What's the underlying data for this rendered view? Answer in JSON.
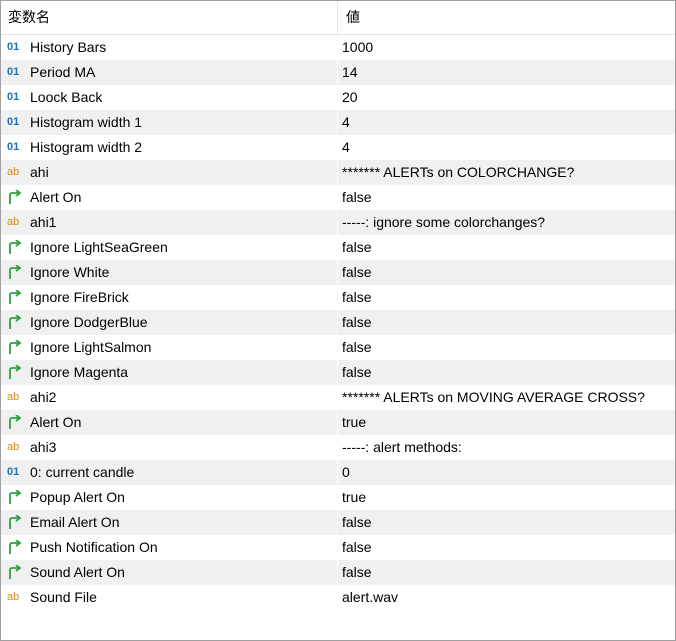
{
  "header": {
    "name": "変数名",
    "value": "値"
  },
  "rows": [
    {
      "type": "int",
      "icon": "int-icon",
      "name": "History Bars",
      "value": "1000"
    },
    {
      "type": "int",
      "icon": "int-icon",
      "name": "Period MA",
      "value": "14"
    },
    {
      "type": "int",
      "icon": "int-icon",
      "name": "Loock Back",
      "value": "20"
    },
    {
      "type": "int",
      "icon": "int-icon",
      "name": "Histogram width 1",
      "value": "4"
    },
    {
      "type": "int",
      "icon": "int-icon",
      "name": "Histogram width 2",
      "value": "4"
    },
    {
      "type": "str",
      "icon": "string-icon",
      "name": "ahi",
      "value": "******* ALERTs on COLORCHANGE?"
    },
    {
      "type": "bool",
      "icon": "bool-icon",
      "name": "Alert On",
      "value": "false"
    },
    {
      "type": "str",
      "icon": "string-icon",
      "name": "ahi1",
      "value": "-----: ignore some colorchanges?"
    },
    {
      "type": "bool",
      "icon": "bool-icon",
      "name": "Ignore LightSeaGreen",
      "value": "false"
    },
    {
      "type": "bool",
      "icon": "bool-icon",
      "name": "Ignore White",
      "value": "false"
    },
    {
      "type": "bool",
      "icon": "bool-icon",
      "name": "Ignore FireBrick",
      "value": "false"
    },
    {
      "type": "bool",
      "icon": "bool-icon",
      "name": "Ignore DodgerBlue",
      "value": "false"
    },
    {
      "type": "bool",
      "icon": "bool-icon",
      "name": "Ignore LightSalmon",
      "value": "false"
    },
    {
      "type": "bool",
      "icon": "bool-icon",
      "name": "Ignore Magenta",
      "value": "false"
    },
    {
      "type": "str",
      "icon": "string-icon",
      "name": "ahi2",
      "value": "******* ALERTs on MOVING AVERAGE CROSS?"
    },
    {
      "type": "bool",
      "icon": "bool-icon",
      "name": "Alert On",
      "value": "true"
    },
    {
      "type": "str",
      "icon": "string-icon",
      "name": "ahi3",
      "value": "-----: alert methods:"
    },
    {
      "type": "int",
      "icon": "int-icon",
      "name": "0: current candle",
      "value": "0"
    },
    {
      "type": "bool",
      "icon": "bool-icon",
      "name": "Popup Alert On",
      "value": "true"
    },
    {
      "type": "bool",
      "icon": "bool-icon",
      "name": "Email Alert On",
      "value": "false"
    },
    {
      "type": "bool",
      "icon": "bool-icon",
      "name": "Push Notification On",
      "value": "false"
    },
    {
      "type": "bool",
      "icon": "bool-icon",
      "name": "Sound Alert On",
      "value": "false"
    },
    {
      "type": "str",
      "icon": "string-icon",
      "name": "Sound File",
      "value": "alert.wav"
    }
  ],
  "icons": {
    "int": "01",
    "str": "ab"
  },
  "colors": {
    "int": "#1e6fb8",
    "str": "#d08a1a",
    "bool": "#2ea043"
  }
}
